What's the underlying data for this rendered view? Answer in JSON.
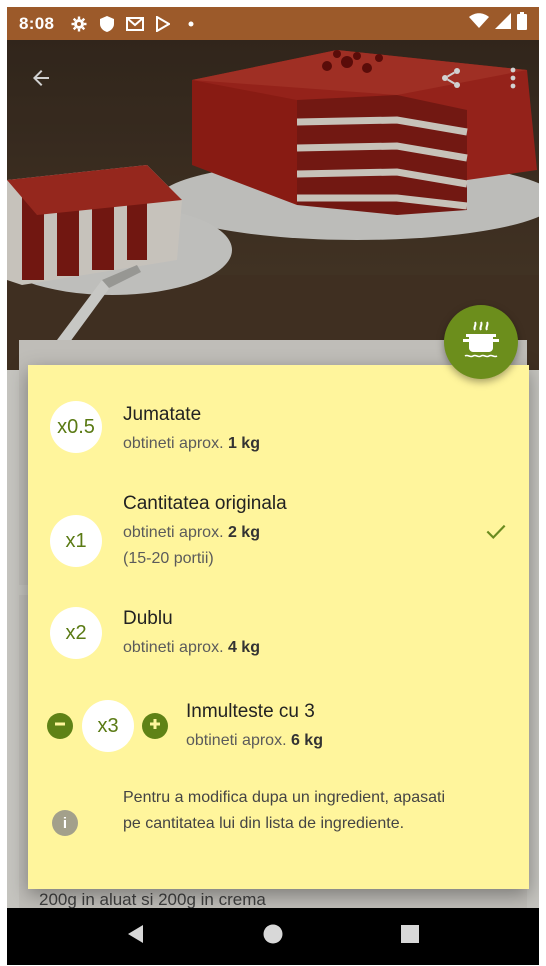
{
  "status_bar": {
    "time": "8:08",
    "icons": [
      "gear-icon",
      "shield-icon",
      "gmail-icon",
      "play-store-icon",
      "dot-icon"
    ],
    "right_icons": [
      "wifi-icon",
      "signal-icon",
      "battery-icon"
    ]
  },
  "app_bar": {
    "back_icon": "arrow-left-icon",
    "share_icon": "share-icon",
    "more_icon": "more-vert-icon"
  },
  "fab": {
    "icon": "cooking-pot-icon"
  },
  "background": {
    "ingredient_note": "200g in aluat si 200g in crema"
  },
  "portion_popup": {
    "options": [
      {
        "multiplier": "x0.5",
        "title": "Jumatate",
        "sub_prefix": "obtineti aprox. ",
        "amount": "1 kg",
        "note": "",
        "selected": false
      },
      {
        "multiplier": "x1",
        "title": "Cantitatea originala",
        "sub_prefix": "obtineti aprox. ",
        "amount": "2 kg",
        "note": "(15-20 portii)",
        "selected": true
      },
      {
        "multiplier": "x2",
        "title": "Dublu",
        "sub_prefix": "obtineti aprox. ",
        "amount": "4 kg",
        "note": "",
        "selected": false
      },
      {
        "multiplier": "x3",
        "title": "Inmulteste cu 3",
        "sub_prefix": "obtineti aprox. ",
        "amount": "6 kg",
        "note": "",
        "selected": false
      }
    ],
    "info_text": "Pentru a modifica dupa un ingredient, apasati pe cantitatea lui din lista de ingrediente."
  },
  "colors": {
    "popup_bg": "#fff59c",
    "accent_green": "#6c8e1c",
    "status_bar": "#9c5a2a"
  }
}
